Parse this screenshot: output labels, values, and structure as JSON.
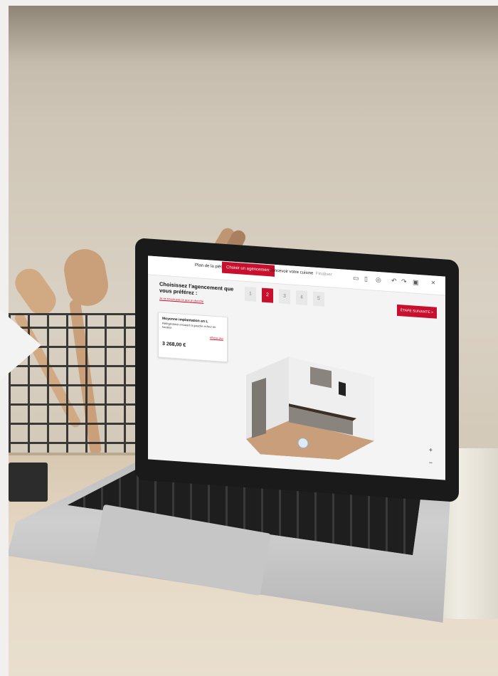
{
  "laptop_ui": {
    "steps": [
      {
        "label": "Plan de la pièce"
      },
      {
        "label": "Choisir un agencement"
      },
      {
        "label": "Concevoir votre cuisine"
      },
      {
        "label": "Finaliser"
      }
    ],
    "tool_icons": [
      "comment-icon",
      "trash-icon",
      "zoom-icon",
      "undo-icon",
      "redo-icon",
      "save-icon",
      "close-icon"
    ],
    "heading": "Choisissez l'agencement que vous préférez :",
    "help_link": "Je ne trouve pas ce que je cherche",
    "layout_numbers": [
      "1",
      "2",
      "3",
      "4",
      "5"
    ],
    "selected_layout": "2",
    "next_button": "ÉTAPE SUIVANTE >",
    "card": {
      "title": "Moyenne implantation en L",
      "description": "Réfrigérateur encastré à gauche et four en hauteur.",
      "link": "Afficher plus",
      "price": "3 268,00 €"
    },
    "zoom_in": "+",
    "zoom_out": "−",
    "accent_color": "#c8102e"
  }
}
